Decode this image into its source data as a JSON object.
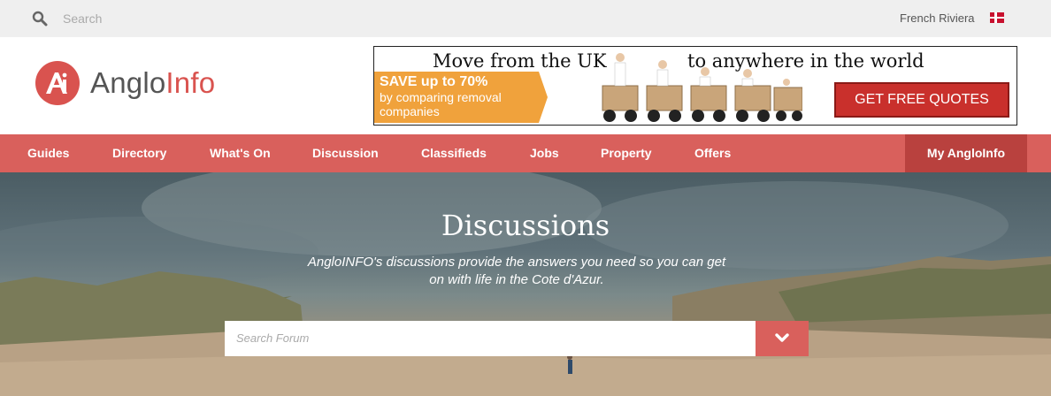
{
  "topbar": {
    "search_placeholder": "Search",
    "region": "French Riviera"
  },
  "logo": {
    "text_start": "Anglo",
    "text_end": "Info"
  },
  "banner": {
    "headline_left": "Move from the UK",
    "headline_right": "to anywhere in the world",
    "save_title": "SAVE up to 70%",
    "save_sub": "by comparing removal companies",
    "cta": "GET FREE QUOTES"
  },
  "nav": {
    "items": [
      {
        "label": "Guides"
      },
      {
        "label": "Directory"
      },
      {
        "label": "What's On"
      },
      {
        "label": "Discussion"
      },
      {
        "label": "Classifieds"
      },
      {
        "label": "Jobs"
      },
      {
        "label": "Property"
      },
      {
        "label": "Offers"
      }
    ],
    "my_label": "My AngloInfo"
  },
  "hero": {
    "title": "Discussions",
    "subtitle": "AngloINFO's discussions provide the answers you need so you can get on with life in the Cote d'Azur.",
    "search_placeholder": "Search Forum"
  },
  "colors": {
    "brand": "#d9534f",
    "nav_bg": "#d9605c",
    "nav_active": "#b9413e"
  }
}
